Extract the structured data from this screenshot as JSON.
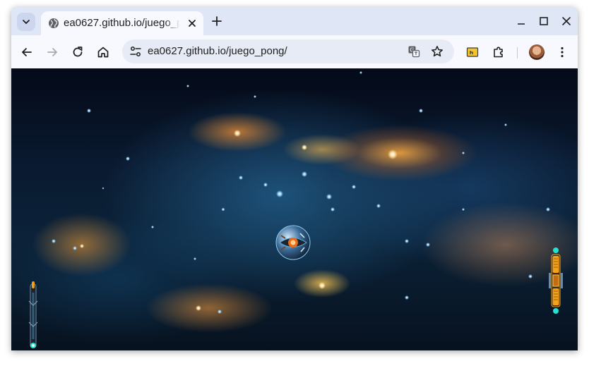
{
  "browser": {
    "tab": {
      "title": "ea0627.github.io/juego_pong/",
      "favicon": "globe-icon"
    },
    "address_bar": {
      "url": "ea0627.github.io/juego_pong/"
    },
    "colors": {
      "frame": "#dfe6f6",
      "toolbar": "#f7f9ff",
      "omnibox": "#e6ebf5"
    }
  },
  "game": {
    "background": "space-nebula",
    "ball": "spaceship-ball",
    "left_paddle": "left-paddle",
    "right_paddle": "right-paddle",
    "accent_colors": {
      "paddle_glow": "#28e0d0",
      "paddle_orange": "#f2a11c"
    }
  }
}
